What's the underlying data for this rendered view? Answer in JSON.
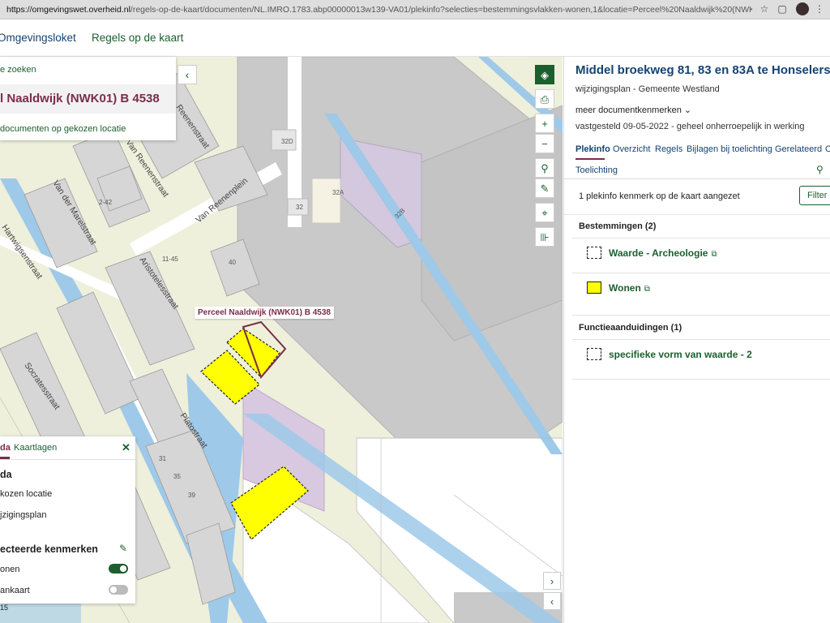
{
  "browser": {
    "url_host": "https://omgevingswet.overheid.nl",
    "url_path": "/regels-op-de-kaart/documenten/NL.IMRO.1783.abp00000013w139-VA01/plekinfo?selecties=bestemmingsvlakken-wonen,1&locatie=Perceel%20Naaldwijk%20(NWK01)%20B%204538&kaa..."
  },
  "header": {
    "app_name": "Omgevingsloket",
    "nav_item": "Regels op de kaart"
  },
  "search_panel": {
    "back_link": "e zoeken",
    "location_title": "l Naaldwijk (NWK01) B 4538",
    "documents_link": "documenten op gekozen locatie"
  },
  "map": {
    "perceel_label": "Perceel Naaldwijk (NWK01) B 4538",
    "streets": [
      "Van der Marelstraat",
      "Van Reenenstraat",
      "Van Reenenplein",
      "Aristotelesstraat",
      "Hartwigsenstraat",
      "Socratesstraat",
      "Platostraat",
      "Reenenstraat"
    ],
    "house_numbers": [
      "32D",
      "32A",
      "32",
      "32B",
      "40",
      "11-45",
      "2-42",
      "39",
      "35",
      "31"
    ],
    "scale_text": "15",
    "colors": {
      "wonen": "#ffff00",
      "water": "#9ec9e9",
      "buildings": "#c8c8c8",
      "perceel_outline": "#7a2d4a"
    }
  },
  "map_tools": {
    "layers_icon": "layers-icon",
    "print_icon": "print-icon",
    "zoom_in": "+",
    "zoom_out": "−",
    "location_icon": "pin-icon",
    "draw_icon": "pencil-icon",
    "locate_icon": "crosshair-icon",
    "measure_icon": "ruler-icon"
  },
  "legend": {
    "tab_active": "da",
    "tab_layers": "Kaartlagen",
    "heading": "da",
    "row1": "kozen locatie",
    "row2": "jzigingsplan",
    "selected_heading": "ecteerde kenmerken",
    "toggle1_label": "onen",
    "toggle1_on": true,
    "toggle2_label": "ankaart",
    "toggle2_on": false
  },
  "document": {
    "title": "Middel broekweg 81, 83 en 83A te Honselersdijk",
    "subtitle": "wijzigingsplan - Gemeente Westland",
    "more_link": "meer documentkenmerken",
    "status": "vastgesteld 09-05-2022 - geheel onherroepelijk in werking",
    "tabs": [
      "Plekinfo",
      "Overzicht",
      "Regels",
      "Bijlagen bij toelichting",
      "Gerelateerd",
      "O"
    ],
    "toelichting": "Toelichting",
    "plekinfo_count_text": "1 plekinfo kenmerk op de kaart aangezet",
    "filter_button": "Filter r",
    "bestemmingen_header": "Bestemmingen (2)",
    "bestemmingen": [
      "Waarde - Archeologie",
      "Wonen"
    ],
    "functie_header": "Functieaanduidingen (1)",
    "functieaanduidingen": [
      "specifieke vorm van waarde - 2"
    ]
  }
}
